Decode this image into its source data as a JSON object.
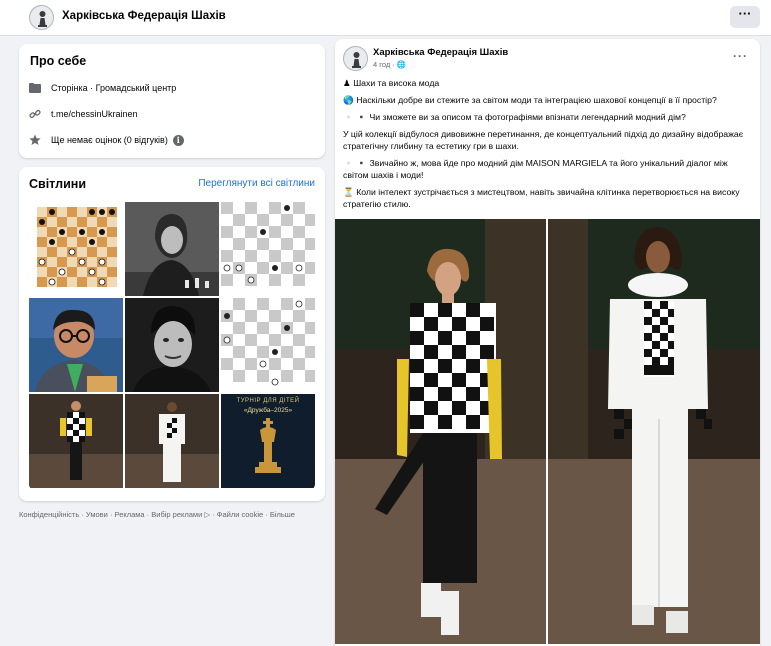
{
  "page": {
    "name": "Харківська Федерація Шахів",
    "more_label": "···"
  },
  "about": {
    "title": "Про себе",
    "category": "Сторінка · Громадський центр",
    "link": "t.me/chessinUkrainen",
    "rating": "Ще немає оцінок (0 відгуків)",
    "info_glyph": "i"
  },
  "photos": {
    "title": "Світлини",
    "see_all": "Переглянути всі світлини",
    "tournament_line1": "ТУРНІР ДЛЯ ДІТЕЙ",
    "tournament_line2": "«Дружба–2025»"
  },
  "footer": {
    "links": "Конфіденційність · Умови · Реклама · Вибір реклами ▷ · Файли cookie · Більше"
  },
  "post": {
    "author": "Харківська Федерація Шахів",
    "time": "4 год · 🌐",
    "more": "···",
    "lines": [
      "♟ Шахи та висока мода",
      "🌎 Наскільки добре ви стежите за світом моди та інтеграцією шахової концепції в її простір?",
      "▫️ ▪️ Чи зможете ви за описом та фотографіями впізнати легендарний модний дім?",
      "У цій колекції відбулося дивовижне перетинання, де концептуальний підхід до дизайну відображає стратегічну глибину та естетику гри в шахи.",
      "▫️ ▪️ Звичайно ж, мова йде про модний дім MAISON MARGIELA та його унікальний діалог між світом шахів і моди!",
      "⏳ Коли інтелект зустрічається з мистецтвом, навіть звичайна клітинка перетворюється на високу стратегію стилю."
    ]
  },
  "icons": {
    "page": "page-icon",
    "link": "link-icon",
    "star": "star-icon",
    "info": "info-icon"
  },
  "colors": {
    "accent": "#216fdb",
    "muted": "#65676b",
    "bg": "#f0f2f5"
  }
}
